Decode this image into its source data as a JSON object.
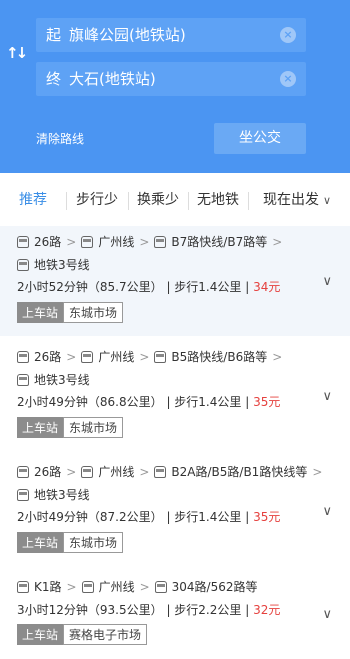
{
  "header": {
    "from_prefix": "起",
    "from_value": "旗峰公园(地铁站)",
    "to_prefix": "终",
    "to_value": "大石(地铁站)",
    "clear_route": "清除路线",
    "bus_button": "坐公交"
  },
  "tabs": [
    {
      "label": "推荐"
    },
    {
      "label": "步行少"
    },
    {
      "label": "换乘少"
    },
    {
      "label": "无地铁"
    },
    {
      "label": "现在出发"
    }
  ],
  "routes": [
    {
      "legs": [
        "26路",
        "广州线",
        "B7路快线/B7路等"
      ],
      "legs2": "地铁3号线",
      "time": "2小时52分钟（85.7公里）",
      "walk": "步行1.4公里",
      "price": "34元",
      "board_label": "上车站",
      "board_station": "东城市场"
    },
    {
      "legs": [
        "26路",
        "广州线",
        "B5路快线/B6路等"
      ],
      "legs2": "地铁3号线",
      "time": "2小时49分钟（86.8公里）",
      "walk": "步行1.4公里",
      "price": "35元",
      "board_label": "上车站",
      "board_station": "东城市场"
    },
    {
      "legs": [
        "26路",
        "广州线",
        "B2A路/B5路/B1路快线等"
      ],
      "legs2": "地铁3号线",
      "time": "2小时49分钟（87.2公里）",
      "walk": "步行1.4公里",
      "price": "35元",
      "board_label": "上车站",
      "board_station": "东城市场"
    },
    {
      "legs": [
        "K1路",
        "广州线",
        "304路/562路等"
      ],
      "time": "3小时12分钟（93.5公里）",
      "walk": "步行2.2公里",
      "price": "32元",
      "board_label": "上车站",
      "board_station": "赛格电子市场"
    }
  ],
  "icons": {
    "swap": "swap-arrows-icon",
    "clear": "clear-circle-icon",
    "bus": "bus-icon",
    "chevron": "chevron-down-icon"
  },
  "colors": {
    "header_bg": "#4b95f2",
    "accent": "#3a8ee6",
    "price": "#e5413e",
    "selected_card_bg": "#f2f6fb"
  }
}
